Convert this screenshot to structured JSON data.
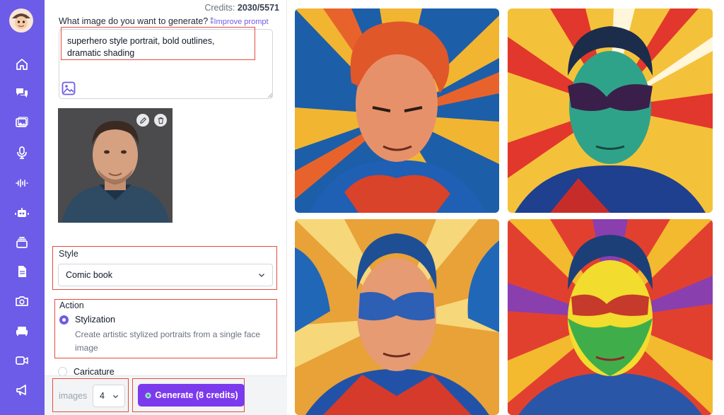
{
  "credits": {
    "label": "Credits:",
    "value": "2030/5571"
  },
  "prompt": {
    "label": "What image do you want to generate?",
    "improve_label": "Improve prompt",
    "value": "superhero style portrait, bold outlines, dramatic shading"
  },
  "style": {
    "label": "Style",
    "selected": "Comic book"
  },
  "action": {
    "label": "Action",
    "options": [
      {
        "title": "Stylization",
        "description": "Create artistic stylized portraits from a single face image",
        "selected": true
      },
      {
        "title": "Caricature",
        "selected": false
      }
    ]
  },
  "images": {
    "label": "images",
    "count": "4"
  },
  "generate": {
    "label": "Generate (8 credits)"
  },
  "sidebar": {
    "items": [
      "home-icon",
      "chat-icon",
      "images-icon",
      "microphone-icon",
      "audio-wave-icon",
      "robot-icon",
      "layers-icon",
      "document-icon",
      "camera-icon",
      "sofa-icon",
      "video-icon",
      "megaphone-icon"
    ]
  },
  "colors": {
    "accent": "#6d5ce8",
    "button": "#7c3aed",
    "highlight": "#e74c3c"
  }
}
